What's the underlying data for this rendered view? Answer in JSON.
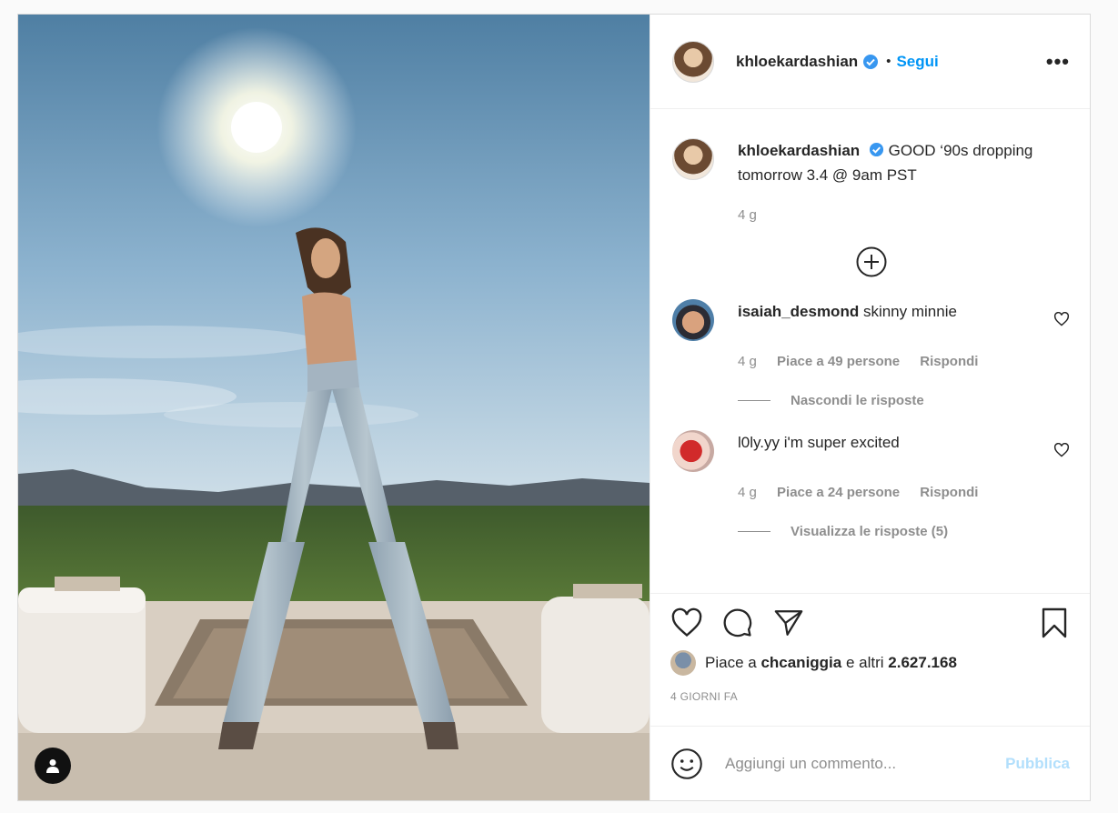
{
  "header": {
    "username": "khloekardashian",
    "separator": "•",
    "follow_label": "Segui",
    "more_label": "•••"
  },
  "caption": {
    "username": "khloekardashian",
    "text": "GOOD ‘90s dropping tomorrow 3.4 @ 9am PST",
    "age": "4 g"
  },
  "comments": [
    {
      "username": "isaiah_desmond",
      "text": "skinny minnie",
      "age": "4 g",
      "likes": "Piace a 49 persone",
      "reply": "Rispondi",
      "replies_toggle": "Nascondi le risposte"
    },
    {
      "username": "l0ly.yy",
      "text": "i'm super excited",
      "age": "4 g",
      "likes": "Piace a 24 persone",
      "reply": "Rispondi",
      "replies_toggle": "Visualizza le risposte (5)"
    }
  ],
  "likes_summary": {
    "prefix": "Piace a",
    "user": "chcaniggia",
    "middle": "e altri",
    "count": "2.627.168"
  },
  "date": "4 GIORNI FA",
  "add_comment": {
    "placeholder": "Aggiungi un commento...",
    "publish_label": "Pubblica"
  },
  "icons": {
    "verified": "verified-badge-icon",
    "like": "heart-icon",
    "comment": "comment-icon",
    "share": "paper-plane-icon",
    "save": "bookmark-icon",
    "emoji": "emoji-icon",
    "load_more": "plus-circle-icon",
    "user_tag": "user-tag-icon"
  },
  "colors": {
    "accent": "#0095f6",
    "publish_disabled": "#b2dffc",
    "muted": "#8e8e8e"
  }
}
